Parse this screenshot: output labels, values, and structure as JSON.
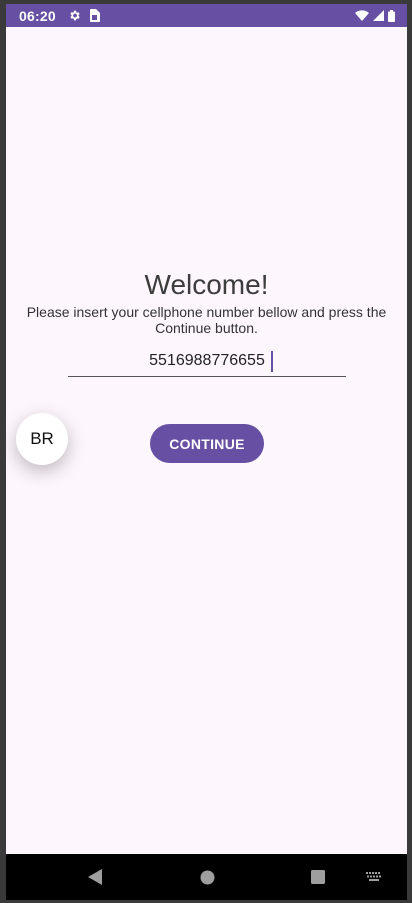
{
  "status_bar": {
    "time": "06:20",
    "icons_left": [
      "settings-icon",
      "sim-card-icon"
    ],
    "icons_right": [
      "wifi-icon",
      "signal-icon",
      "battery-icon"
    ],
    "color": "#6750a4"
  },
  "main": {
    "title": "Welcome!",
    "instructions": "Please insert your cellphone number bellow and press the Continue button.",
    "phone_value": "5516988776655",
    "continue_label": "CONTINUE"
  },
  "country_fab": {
    "label": "BR"
  },
  "nav_bar": {
    "buttons": [
      "back-icon",
      "home-icon",
      "recents-icon",
      "keyboard-icon"
    ]
  },
  "theme": {
    "accent": "#6750a4",
    "background": "#fdf6fd"
  }
}
